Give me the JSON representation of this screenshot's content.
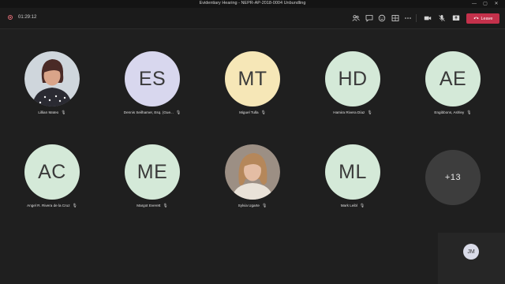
{
  "window": {
    "title": "Evidentiary Hearing - NEPR-AP-2018-0004 Unbundling",
    "controls": {
      "minimize": "—",
      "maximize": "▢",
      "close": "✕"
    }
  },
  "meeting": {
    "timer": "01:29:12",
    "leave_label": "Leave",
    "toolbar_icons": [
      "people-icon",
      "chat-icon",
      "reactions-icon",
      "rooms-icon",
      "more-icon",
      "camera-icon",
      "mic-icon",
      "share-icon"
    ]
  },
  "participants": [
    {
      "name": "Lillian Mateo",
      "type": "photo"
    },
    {
      "name": "Dennis Seilhamer, Esq. (Gue...",
      "initials": "ES",
      "color": "#d8d7ee"
    },
    {
      "name": "Miguel Tulla",
      "initials": "MT",
      "color": "#f6e7b7"
    },
    {
      "name": "Hamira Rivera Díaz",
      "initials": "HD",
      "color": "#d4e9d8"
    },
    {
      "name": "Engibbons, Ashley",
      "initials": "AE",
      "color": "#d4e9d8"
    },
    {
      "name": "Angel R. Rivera de la Cruz",
      "initials": "AC",
      "color": "#d4e9d8"
    },
    {
      "name": "Margot Everett",
      "initials": "ME",
      "color": "#d4e9d8"
    },
    {
      "name": "Sylvia Ugarte",
      "type": "photo"
    },
    {
      "name": "Mark Leibl",
      "initials": "ML",
      "color": "#d4e9d8"
    }
  ],
  "overflow": {
    "label": "+13"
  },
  "self_view": {
    "initials": "JM"
  },
  "mic_glyph": "🎙"
}
